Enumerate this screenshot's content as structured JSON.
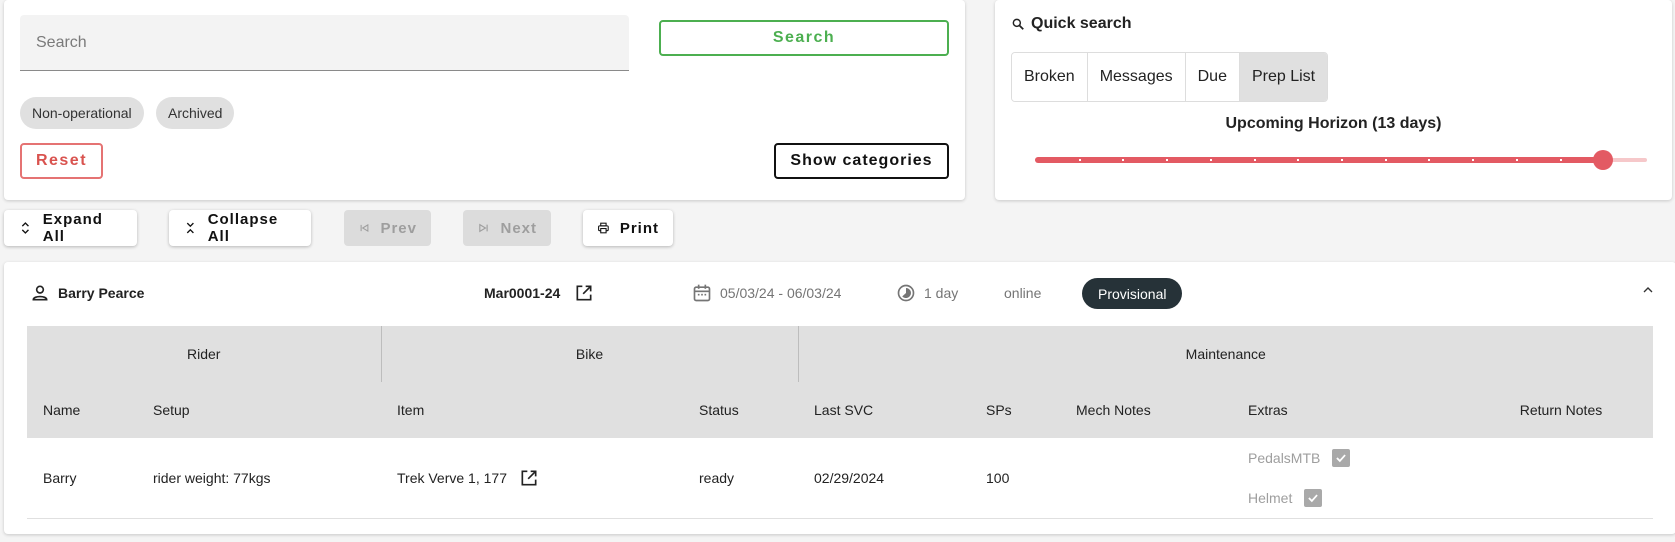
{
  "search": {
    "placeholder": "Search",
    "button_label": "Search",
    "chips": [
      "Non-operational",
      "Archived"
    ],
    "reset_label": "Reset",
    "show_categories_label": "Show categories"
  },
  "quick_search": {
    "title": "Quick search",
    "buttons": [
      "Broken",
      "Messages",
      "Due",
      "Prep List"
    ],
    "active": "Prep List",
    "slider_label": "Upcoming Horizon (13 days)",
    "slider_value": 13,
    "slider_max": 14
  },
  "toolbar": {
    "expand_all": "Expand All",
    "collapse_all": "Collapse All",
    "prev": "Prev",
    "next": "Next",
    "print": "Print"
  },
  "booking": {
    "customer": "Barry Pearce",
    "reference": "Mar0001-24",
    "dates": "05/03/24 - 06/03/24",
    "duration": "1 day",
    "channel": "online",
    "status": "Provisional",
    "groups": [
      "Rider",
      "Bike",
      "Maintenance"
    ],
    "columns": [
      "Name",
      "Setup",
      "Item",
      "Status",
      "Last SVC",
      "SPs",
      "Mech Notes",
      "Extras",
      "Return Notes"
    ],
    "rows": [
      {
        "name": "Barry",
        "setup": "rider weight: 77kgs",
        "item": "Trek Verve 1, 177",
        "status": "ready",
        "last_svc": "02/29/2024",
        "sps": "100",
        "mech_notes": "",
        "extras": [
          "PedalsMTB",
          "Helmet"
        ],
        "return_notes": ""
      }
    ]
  },
  "colors": {
    "success": "#4caf50",
    "danger": "#e35a63",
    "badge": "#263238"
  }
}
